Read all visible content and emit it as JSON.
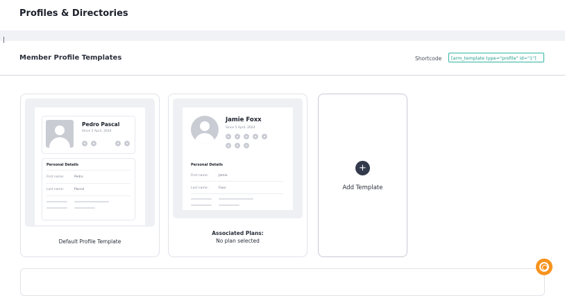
{
  "page": {
    "title": "Profiles & Directories"
  },
  "section": {
    "title": "Member Profile Templates",
    "shortcode_label": "Shortcode",
    "shortcode_value": "[arm_template type=\"profile\" id=\"1\"]"
  },
  "templates": [
    {
      "profile_name": "Pedro Pascal",
      "since": "Since 5 April, 2024",
      "details_title": "Personal Details",
      "fields": [
        {
          "key": "First name:",
          "value": "Pedro"
        },
        {
          "key": "Last name:",
          "value": "Pascal"
        }
      ],
      "label": "Default Profile Template"
    },
    {
      "profile_name": "Jamie Foxx",
      "since": "Since 5 April, 2024",
      "details_title": "Personal Details",
      "fields": [
        {
          "key": "First name:",
          "value": "Jamie"
        },
        {
          "key": "Last name:",
          "value": "Foxx"
        }
      ],
      "associated_title": "Associated Plans:",
      "associated_value": "No plan selected"
    }
  ],
  "add_template": {
    "label": "Add Template",
    "icon": "plus-icon"
  },
  "help": {
    "icon": "help-lifebuoy-icon",
    "color": "#f7931e"
  },
  "colors": {
    "accent": "#2fb3a0",
    "dark_button": "#323a4c",
    "placeholder": "#c9ccd3"
  }
}
